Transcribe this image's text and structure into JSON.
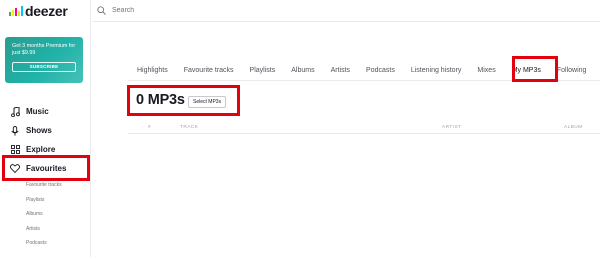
{
  "brand": {
    "name": "deezer",
    "logo_colors": [
      "#40ab5d",
      "#ffed00",
      "#ff0092",
      "#c2ff00",
      "#00c7f2"
    ]
  },
  "promo": {
    "text": "Get 3 months Premium for just $9.99",
    "button": "SUBSCRIBE"
  },
  "search": {
    "placeholder": "Search"
  },
  "nav": {
    "items": [
      {
        "label": "Music",
        "icon": "music-note-icon"
      },
      {
        "label": "Shows",
        "icon": "microphone-icon"
      },
      {
        "label": "Explore",
        "icon": "grid-icon"
      },
      {
        "label": "Favourites",
        "icon": "heart-icon"
      }
    ],
    "sub_items": [
      "Favourite tracks",
      "Playlists",
      "Albums",
      "Artists",
      "Podcasts"
    ]
  },
  "tabs": [
    "Highlights",
    "Favourite tracks",
    "Playlists",
    "Albums",
    "Artists",
    "Podcasts",
    "Listening history",
    "Mixes",
    "My MP3s",
    "Following"
  ],
  "active_tab": "My MP3s",
  "main": {
    "title": "0 MP3s",
    "select_button": "Select MP3s"
  },
  "table": {
    "columns": [
      "#",
      "TRACK",
      "ARTIST",
      "ALBUM"
    ]
  },
  "colors": {
    "highlight": "#e3000f",
    "promo": "#2a9d8f",
    "text": "#191922"
  }
}
